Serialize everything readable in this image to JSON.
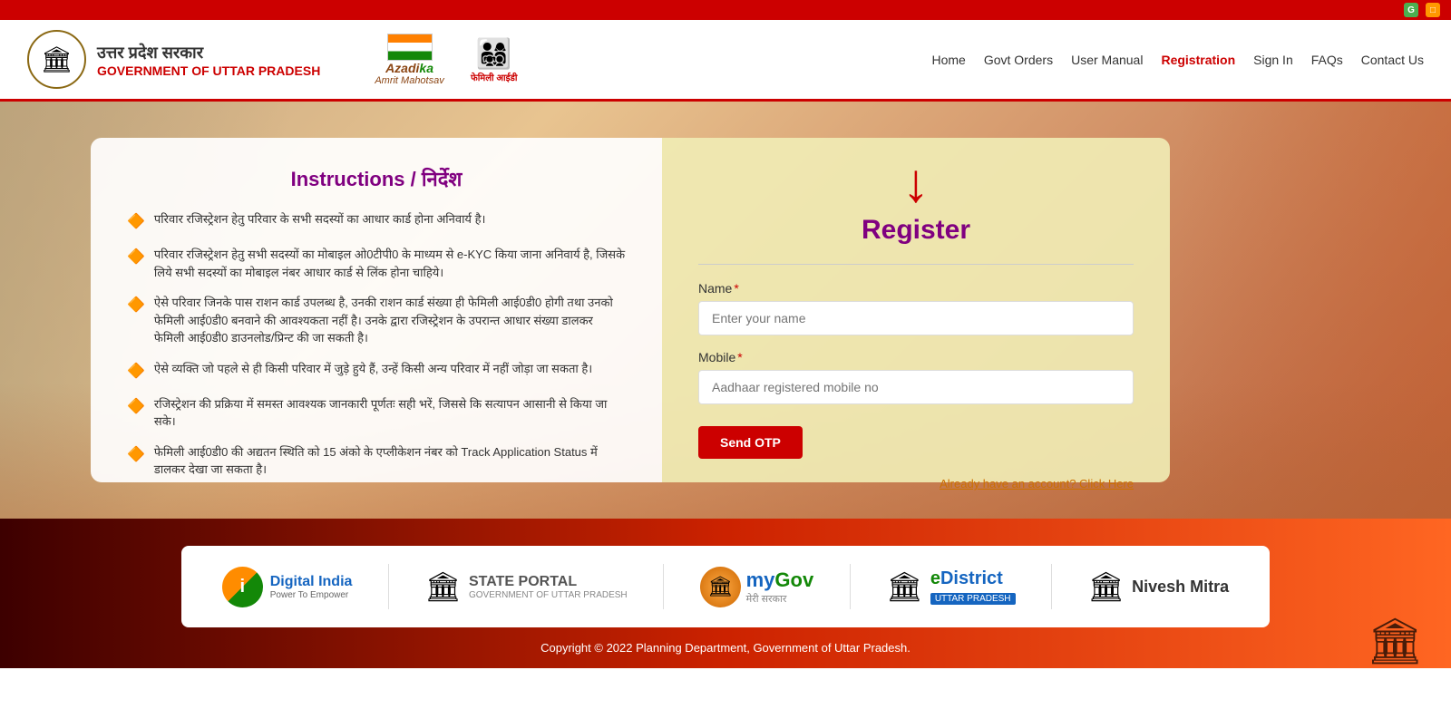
{
  "topbar": {
    "icon1": "G",
    "icon2": "□"
  },
  "header": {
    "emblem": "🏛",
    "title_hindi": "उत्तर प्रदेश सरकार",
    "title_english": "GOVERNMENT OF UTTAR PRADESH",
    "azadi_line1": "Azadi ka",
    "azadi_line2": "Amrit Mahotsav",
    "family_text": "फेमिली आईडी",
    "nav": {
      "home": "Home",
      "govt_orders": "Govt Orders",
      "user_manual": "User Manual",
      "registration": "Registration",
      "sign_in": "Sign In",
      "faqs": "FAQs",
      "contact_us": "Contact Us"
    }
  },
  "instructions": {
    "title": "Instructions / निर्देश",
    "items": [
      "परिवार रजिस्ट्रेशन हेतु परिवार के सभी सदस्यों का आधार कार्ड होना अनिवार्य है।",
      "परिवार रजिस्ट्रेशन हेतु सभी सदस्यों का मोबाइल ओ0टीपी0 के माध्यम से e-KYC किया जाना अनिवार्य है, जिसके लिये सभी सदस्यों का मोबाइल नंबर आधार कार्ड से लिंक होना चाहिये।",
      "ऐसे परिवार जिनके पास राशन कार्ड उपलब्ध है, उनकी राशन कार्ड संख्या ही फेमिली आई0डी0 होगी तथा उनको फेमिली आई0डी0 बनवाने की आवश्यकता नहीं है। उनके द्वारा रजिस्ट्रेशन के उपरान्त आधार संख्या डालकर फेमिली आई0डी0 डाउनलोड/प्रिन्ट की जा सकती है।",
      "ऐसे व्यक्ति जो पहले से ही किसी परिवार में जुड़े हुये हैं, उन्हें किसी अन्य परिवार में नहीं जोड़ा जा सकता है।",
      "रजिस्ट्रेशन की प्रक्रिया में समस्त आवश्यक जानकारी पूर्णतः सही भरें, जिससे कि सत्यापन आसानी से किया जा सके।",
      "फेमिली आई0डी0 की अद्यतन स्थिति को 15 अंको के एप्लीकेशन नंबर को Track Application Status में डालकर देखा जा सकता है।"
    ]
  },
  "register": {
    "title": "Register",
    "name_label": "Name",
    "name_required": "*",
    "name_placeholder": "Enter your name",
    "mobile_label": "Mobile",
    "mobile_required": "*",
    "mobile_placeholder": "Aadhaar registered mobile no",
    "send_otp_button": "Send OTP",
    "already_account": "Already have an account? Click Here"
  },
  "footer": {
    "logos": [
      {
        "id": "digital-india",
        "name": "Digital India",
        "tagline": "Power To Empower"
      },
      {
        "id": "state-portal",
        "name": "STATE PORTAL",
        "tagline": "GOVERNMENT OF UTTAR PRADESH"
      },
      {
        "id": "mygov",
        "name": "myGov",
        "tagline": "मेरी सरकार"
      },
      {
        "id": "edistrict",
        "name": "eDistrict",
        "tagline": "UTTAR PRADESH"
      },
      {
        "id": "nivesh-mitra",
        "name": "Nivesh Mitra",
        "tagline": ""
      }
    ],
    "copyright": "Copyright © 2022 Planning Department, Government of Uttar Pradesh."
  }
}
